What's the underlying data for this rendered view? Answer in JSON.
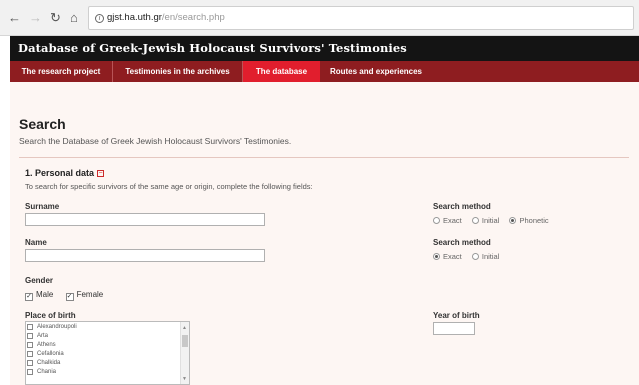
{
  "browser": {
    "url_host": "gjst.ha.uth.gr",
    "url_path": "/en/search.php"
  },
  "site": {
    "title": "Database of Greek-Jewish Holocaust Survivors' Testimonies",
    "nav": [
      "The research project",
      "Testimonies in the archives",
      "The database",
      "Routes and experiences"
    ],
    "active_nav": "The database"
  },
  "page": {
    "title": "Search",
    "subtitle": "Search the Database of Greek Jewish Holocaust Survivors' Testimonies."
  },
  "section": {
    "title": "1. Personal data",
    "collapse_symbol": "−",
    "description": "To search for specific survivors of the same age or origin, complete the following fields:"
  },
  "fields": {
    "surname_label": "Surname",
    "surname_value": "",
    "name_label": "Name",
    "name_value": "",
    "gender_label": "Gender",
    "gender_options": [
      "Male",
      "Female"
    ],
    "place_label": "Place of birth",
    "places": [
      "Alexandroupoli",
      "Arta",
      "Athens",
      "Cefallonia",
      "Chalkida",
      "Chania"
    ],
    "year_label": "Year of birth",
    "year_value": "",
    "search_method_label": "Search method",
    "surname_methods": [
      "Exact",
      "Initial",
      "Phonetic"
    ],
    "surname_method_selected": "Phonetic",
    "name_methods": [
      "Exact",
      "Initial"
    ],
    "name_method_selected": "Exact"
  },
  "colors": {
    "header_bg": "#141414",
    "nav_bg": "#8e1d20",
    "nav_active": "#e11e2d",
    "body_bg": "#fdf6f3"
  }
}
